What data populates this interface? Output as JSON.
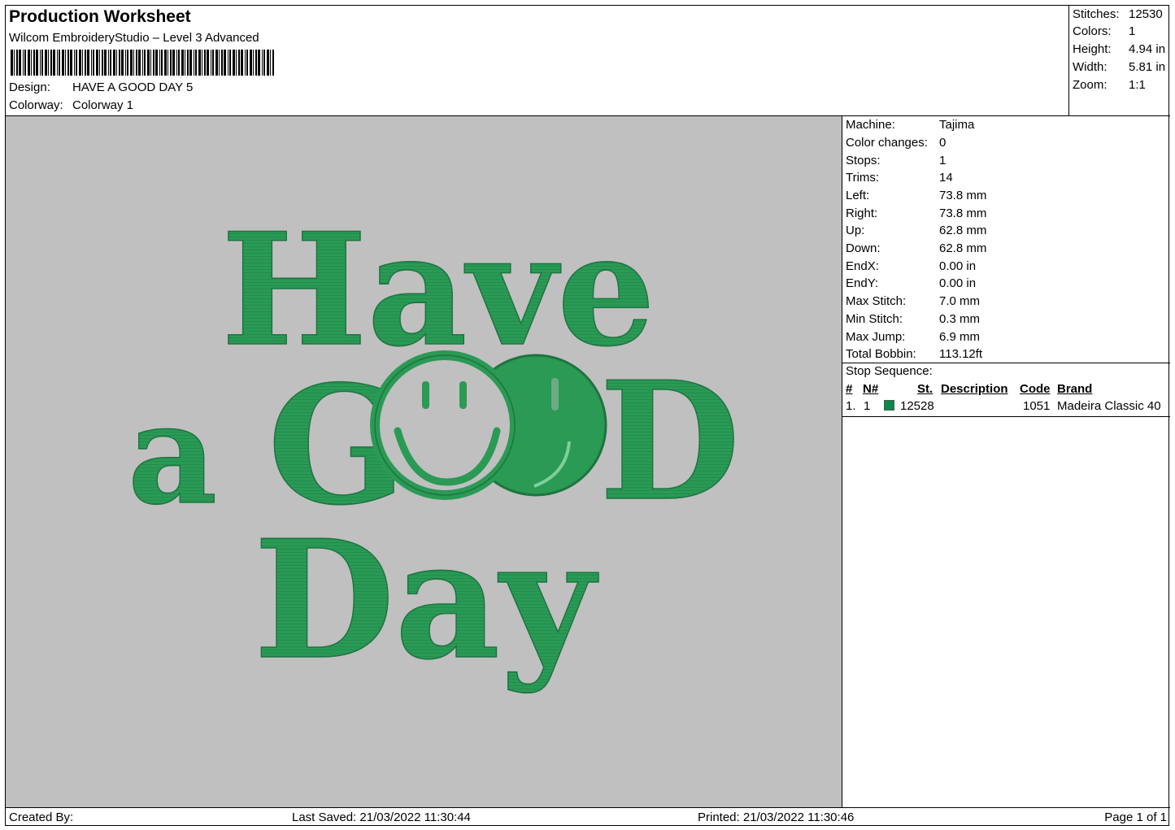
{
  "header": {
    "title": "Production Worksheet",
    "software": "Wilcom EmbroideryStudio – Level 3 Advanced",
    "design_label": "Design:",
    "design_value": "HAVE A GOOD DAY 5",
    "colorway_label": "Colorway:",
    "colorway_value": "Colorway 1"
  },
  "summary": [
    {
      "label": "Stitches:",
      "value": "12530"
    },
    {
      "label": "Colors:",
      "value": "1"
    },
    {
      "label": "Height:",
      "value": "4.94 in"
    },
    {
      "label": "Width:",
      "value": "5.81 in"
    },
    {
      "label": "Zoom:",
      "value": "1:1"
    }
  ],
  "details": [
    {
      "label": "Machine:",
      "value": "Tajima"
    },
    {
      "label": "Color changes:",
      "value": "0"
    },
    {
      "label": "Stops:",
      "value": "1"
    },
    {
      "label": "Trims:",
      "value": "14"
    },
    {
      "label": "Left:",
      "value": "73.8 mm"
    },
    {
      "label": "Right:",
      "value": "73.8 mm"
    },
    {
      "label": "Up:",
      "value": "62.8 mm"
    },
    {
      "label": "Down:",
      "value": "62.8 mm"
    },
    {
      "label": "EndX:",
      "value": "0.00 in"
    },
    {
      "label": "EndY:",
      "value": "0.00 in"
    },
    {
      "label": "Max Stitch:",
      "value": "7.0 mm"
    },
    {
      "label": "Min Stitch:",
      "value": "0.3 mm"
    },
    {
      "label": "Max Jump:",
      "value": "6.9 mm"
    },
    {
      "label": "Total Bobbin:",
      "value": "113.12ft"
    }
  ],
  "stop_sequence": {
    "title": "Stop Sequence:",
    "columns": [
      "#",
      "N#",
      "St.",
      "Description",
      "Code",
      "Brand"
    ],
    "rows": [
      {
        "index": "1.",
        "needle": "1",
        "color": "#0a8a4a",
        "stitches": "12528",
        "description": "",
        "code": "1051",
        "brand": "Madeira Classic 40"
      }
    ]
  },
  "design": {
    "background": "#c0c0c0",
    "thread_color": "#2a9a55",
    "lines": [
      "Have",
      "a",
      "G",
      "OO",
      "D",
      "Day"
    ]
  },
  "footer": {
    "created_by": "Created By:",
    "last_saved": "Last Saved: 21/03/2022 11:30:44",
    "printed": "Printed: 21/03/2022 11:30:46",
    "page": "Page 1 of 1"
  }
}
